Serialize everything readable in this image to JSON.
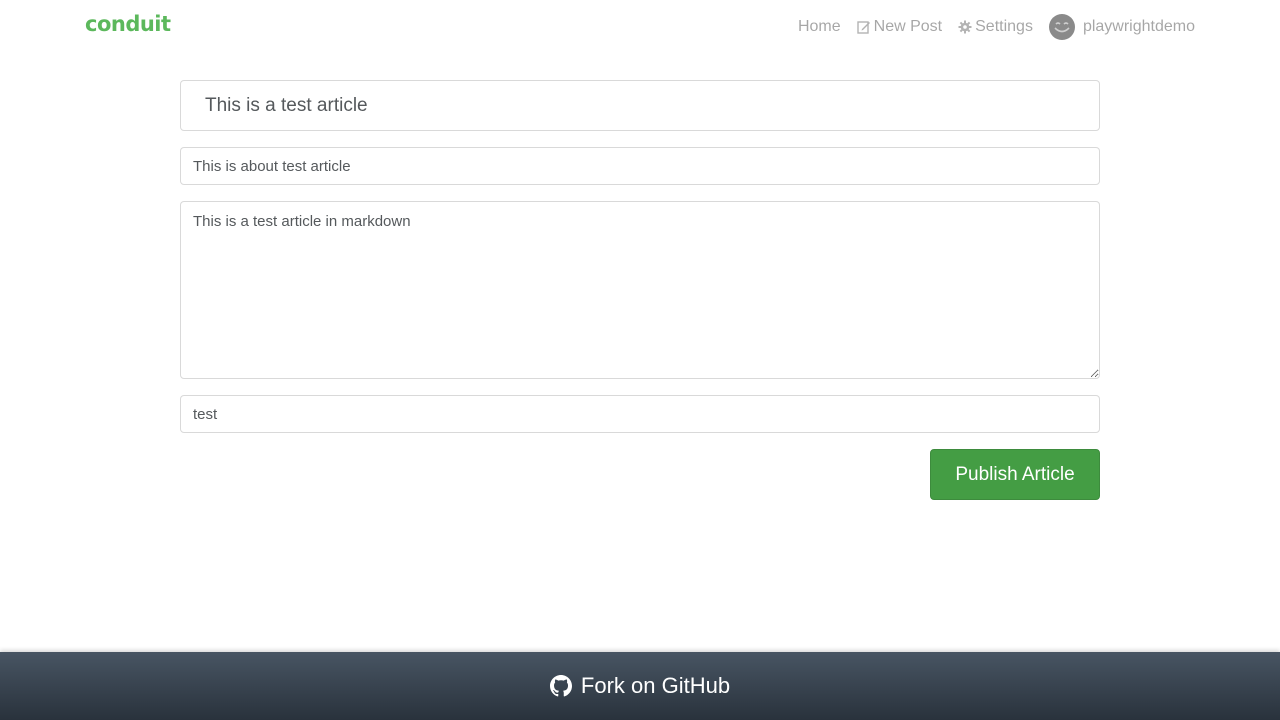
{
  "header": {
    "brand": "conduit",
    "nav": {
      "home": "Home",
      "new_post": "New Post",
      "settings": "Settings",
      "username": "playwrightdemo"
    }
  },
  "editor": {
    "title_value": "This is a test article",
    "about_value": "This is about test article",
    "body_value": "This is a test article in markdown",
    "tags_value": "test",
    "publish_label": "Publish Article"
  },
  "footer": {
    "github_label": "Fork on GitHub"
  },
  "colors": {
    "brand": "#5cb85c",
    "button": "#449d44",
    "footer_top": "#485563",
    "footer_bottom": "#29323c"
  },
  "icons": {
    "new_post": "edit-icon",
    "settings": "gear-icon",
    "avatar": "smiley-avatar",
    "github": "github-icon"
  }
}
